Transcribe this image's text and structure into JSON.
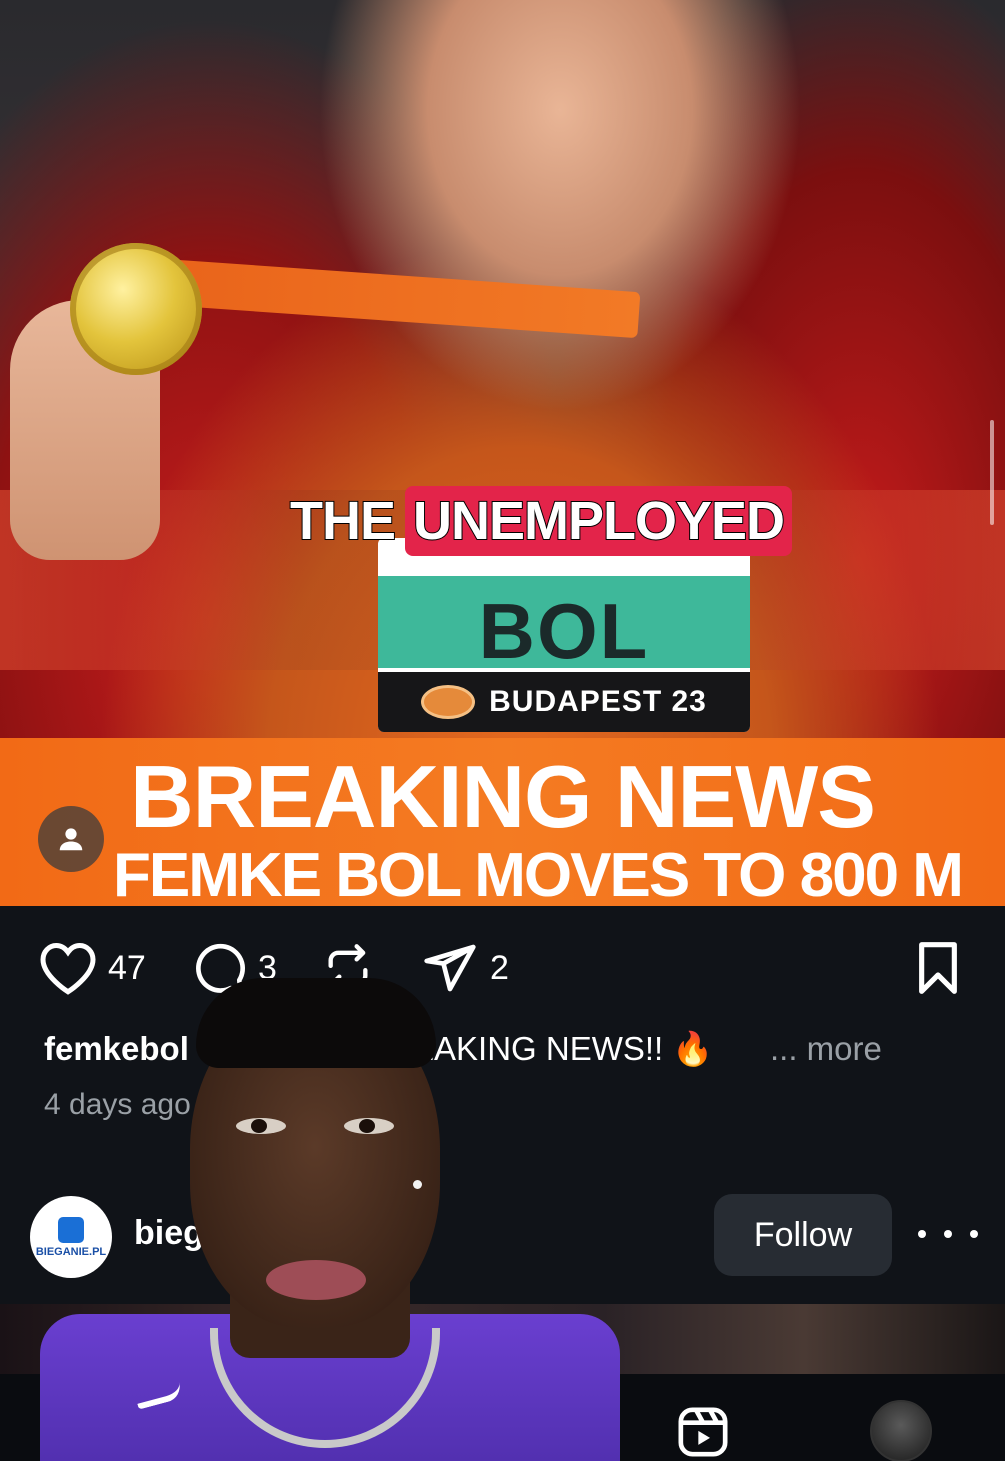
{
  "post": {
    "overlay_caption": {
      "word1": "THE",
      "word2": "UNEMPLOYED"
    },
    "bib": {
      "name": "BOL",
      "event": "BUDAPEST 23"
    },
    "banner": {
      "title": "BREAKING NEWS",
      "subtitle": "FEMKE BOL MOVES TO 800 M"
    }
  },
  "actions": {
    "likes": "47",
    "comments": "3",
    "shares": "2"
  },
  "caption": {
    "username": "femkebol",
    "text": "EAKING NEWS!! 🔥",
    "more": "... more",
    "timestamp": "4 days ago"
  },
  "next_post": {
    "avatar_text": "BIEGANIE.PL",
    "username": "bieg",
    "follow_label": "Follow"
  },
  "icons": {
    "like": "heart-icon",
    "comment": "comment-bubble-icon",
    "repost": "repost-icon",
    "share": "send-icon",
    "save": "bookmark-icon",
    "reels": "reels-icon",
    "tag": "person-tag-icon"
  },
  "colors": {
    "banner": "#f26a16",
    "caption_highlight": "#e3244a",
    "follow_button": "#272c33",
    "background": "#101318"
  }
}
